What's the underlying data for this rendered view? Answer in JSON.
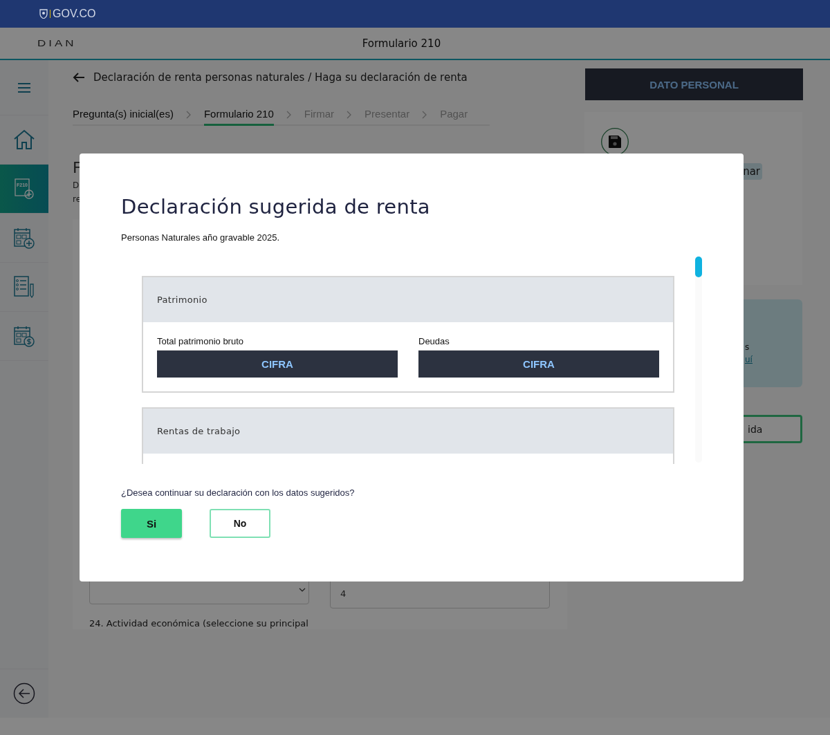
{
  "gov_bar": {
    "logo_text": "GOV.CO"
  },
  "header": {
    "logo": "DIAN",
    "title": "Formulario 210"
  },
  "sidebar": {
    "items": [
      {
        "kind": "menu",
        "selected": false
      },
      {
        "kind": "home",
        "selected": false
      },
      {
        "kind": "form",
        "badge": "F210",
        "selected": true
      },
      {
        "kind": "calendar-add",
        "selected": false
      },
      {
        "kind": "checklist",
        "selected": false
      },
      {
        "kind": "calendar-pay",
        "selected": false
      }
    ]
  },
  "breadcrumb": {
    "text": "Declaración de renta personas naturales / Haga su declaración de renta"
  },
  "steps": [
    {
      "label": "Pregunta(s) inicial(es)",
      "selected": false,
      "disabled": false
    },
    {
      "label": "Formulario 210",
      "selected": true,
      "disabled": false
    },
    {
      "label": "Firmar",
      "selected": false,
      "disabled": true
    },
    {
      "label": "Presentar",
      "selected": false,
      "disabled": true
    },
    {
      "label": "Pagar",
      "selected": false,
      "disabled": true
    }
  ],
  "personal_button": {
    "label": "DATO PERSONAL"
  },
  "form_card": {
    "heading": "F",
    "lines": [
      "D",
      "re"
    ],
    "fields": [
      {
        "kind": "select"
      },
      {
        "kind": "input",
        "value": "4"
      }
    ],
    "next_label": "24. Actividad económica (seleccione su principal"
  },
  "side_panel": {
    "chip": "nar",
    "info_text": "s",
    "info_link": "uí",
    "button": "ida"
  },
  "modal": {
    "title": "Declaración sugerida de renta",
    "subtitle": "Personas Naturales año gravable 2025.",
    "sections": [
      {
        "title": "Patrimonio",
        "fields": [
          {
            "label": "Total patrimonio bruto",
            "value": "CIFRA"
          },
          {
            "label": "Deudas",
            "value": "CIFRA"
          }
        ]
      },
      {
        "title": "Rentas de trabajo"
      }
    ],
    "question": "¿Desea continuar su declaración con los datos sugeridos?",
    "buttons": [
      {
        "label": "Si",
        "kind": "primary"
      },
      {
        "label": "No",
        "kind": "secondary"
      }
    ]
  }
}
